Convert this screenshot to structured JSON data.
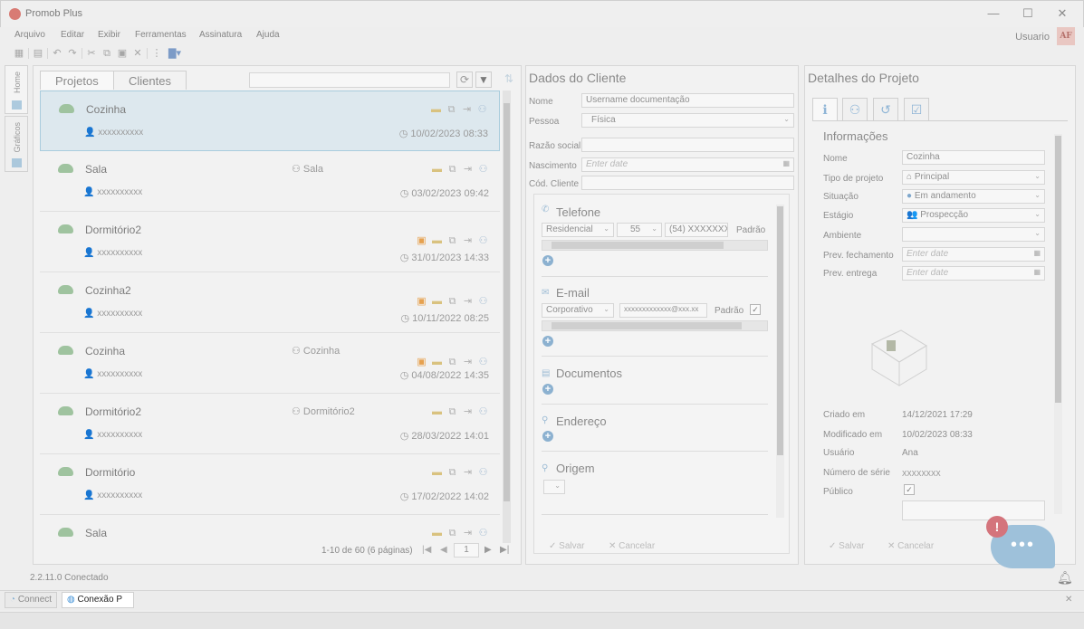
{
  "window": {
    "title": "Promob Plus",
    "min": "—",
    "max": "☐",
    "close": "✕"
  },
  "menu": [
    "Arquivo",
    "Editar",
    "Exibir",
    "Ferramentas",
    "Assinatura",
    "Ajuda"
  ],
  "user": {
    "label": "Usuario",
    "initials": "AF"
  },
  "side_tabs": [
    "Home",
    "Gráficos"
  ],
  "projects": {
    "tabs": [
      "Projetos",
      "Clientes"
    ],
    "rows": [
      {
        "name": "Cozinha",
        "environment": "",
        "user": "xxxxxxxxxx",
        "date": "10/02/2023 08:33",
        "person": false
      },
      {
        "name": "Sala",
        "environment": "Sala",
        "user": "xxxxxxxxxx",
        "date": "03/02/2023 09:42",
        "person": false
      },
      {
        "name": "Dormitório2",
        "environment": "",
        "user": "xxxxxxxxxx",
        "date": "31/01/2023 14:33",
        "person": true
      },
      {
        "name": "Cozinha2",
        "environment": "",
        "user": "xxxxxxxxxx",
        "date": "10/11/2022 08:25",
        "person": true
      },
      {
        "name": "Cozinha",
        "environment": "Cozinha",
        "user": "xxxxxxxxxx",
        "date": "04/08/2022 14:35",
        "person": true
      },
      {
        "name": "Dormitório2",
        "environment": "Dormitório2",
        "user": "xxxxxxxxxx",
        "date": "28/03/2022 14:01",
        "person": false
      },
      {
        "name": "Dormitório",
        "environment": "",
        "user": "xxxxxxxxxx",
        "date": "17/02/2022 14:02",
        "person": false
      },
      {
        "name": "Sala",
        "environment": "",
        "user": "",
        "date": "",
        "person": false
      }
    ],
    "pager": "1-10 de 60 (6 páginas)",
    "page": "1"
  },
  "client": {
    "title": "Dados do Cliente",
    "fields": {
      "nome_label": "Nome",
      "nome_value": "Username documentação",
      "pessoa_label": "Pessoa",
      "pessoa_value": "Física",
      "razao_label": "Razão social",
      "nascimento_label": "Nascimento",
      "nascimento_placeholder": "Enter date",
      "cod_label": "Cód. Cliente"
    },
    "telefone": {
      "title": "Telefone",
      "type": "Residencial",
      "ddi": "55",
      "number": "(54) XXXXXXXX",
      "default_label": "Padrão"
    },
    "email": {
      "title": "E-mail",
      "type": "Corporativo",
      "value": "xxxxxxxxxxxxx@xxx.xx",
      "default_label": "Padrão"
    },
    "documentos": {
      "title": "Documentos"
    },
    "endereco": {
      "title": "Endereço"
    },
    "origem": {
      "title": "Origem"
    },
    "save": "Salvar",
    "cancel": "Cancelar"
  },
  "details": {
    "title": "Detalhes do Projeto",
    "section": "Informações",
    "nome_label": "Nome",
    "nome_value": "Cozinha",
    "tipo_label": "Tipo de projeto",
    "tipo_value": "Principal",
    "situacao_label": "Situação",
    "situacao_value": "Em andamento",
    "estagio_label": "Estágio",
    "estagio_value": "Prospecção",
    "ambiente_label": "Ambiente",
    "prev_fech_label": "Prev. fechamento",
    "prev_fech_placeholder": "Enter date",
    "prev_entrega_label": "Prev. entrega",
    "prev_entrega_placeholder": "Enter date",
    "criado_label": "Criado em",
    "criado_value": "14/12/2021 17:29",
    "modificado_label": "Modificado em",
    "modificado_value": "10/02/2023 08:33",
    "usuario_label": "Usuário",
    "usuario_value": "Ana",
    "serie_label": "Número de série",
    "serie_value": "XXXXXXXX",
    "publico_label": "Público",
    "save": "Salvar",
    "cancel": "Cancelar"
  },
  "status": {
    "text": "2.2.11.0 Conectado"
  },
  "bottom_tabs": [
    "Connect",
    "Conexão P"
  ],
  "chat": {
    "badge": "!",
    "dots": "•••"
  }
}
